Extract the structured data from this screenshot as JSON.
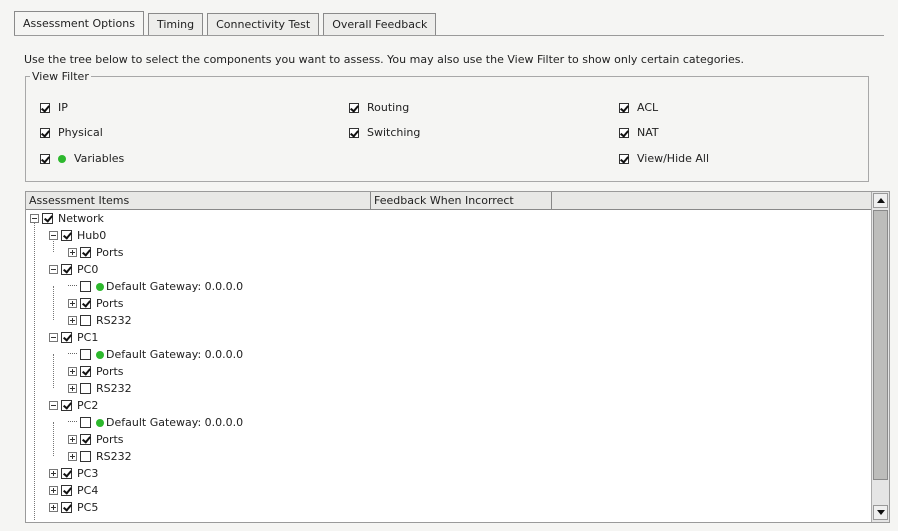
{
  "tabs": [
    {
      "label": "Assessment Options",
      "active": true
    },
    {
      "label": "Timing",
      "active": false
    },
    {
      "label": "Connectivity Test",
      "active": false
    },
    {
      "label": "Overall Feedback",
      "active": false
    }
  ],
  "intro": "Use the tree below to select the components you want to assess. You may also use the View Filter to show only certain categories.",
  "view_filter": {
    "legend": "View Filter",
    "items": [
      {
        "label": "IP",
        "checked": true
      },
      {
        "label": "Routing",
        "checked": true
      },
      {
        "label": "ACL",
        "checked": true
      },
      {
        "label": "Physical",
        "checked": true
      },
      {
        "label": "Switching",
        "checked": true
      },
      {
        "label": "NAT",
        "checked": true
      },
      {
        "label": "Variables",
        "checked": true,
        "dot_color": "#2db82d"
      },
      {
        "label": "View/Hide All",
        "checked": true
      }
    ]
  },
  "grid": {
    "columns": [
      "Assessment Items",
      "Feedback When Incorrect",
      ""
    ],
    "tree": [
      {
        "label": "Network",
        "checked": true,
        "expander": "minus",
        "level": 0
      },
      {
        "label": "Hub0",
        "checked": true,
        "expander": "minus",
        "level": 1
      },
      {
        "label": "Ports",
        "checked": true,
        "expander": "plus",
        "level": 2
      },
      {
        "label": "PC0",
        "checked": true,
        "expander": "minus",
        "level": 1
      },
      {
        "label": "Default Gateway: 0.0.0.0",
        "checked": false,
        "expander": "leaf",
        "level": 2,
        "dot": true
      },
      {
        "label": "Ports",
        "checked": true,
        "expander": "plus",
        "level": 2
      },
      {
        "label": "RS232",
        "checked": false,
        "expander": "plus",
        "level": 2
      },
      {
        "label": "PC1",
        "checked": true,
        "expander": "minus",
        "level": 1
      },
      {
        "label": "Default Gateway: 0.0.0.0",
        "checked": false,
        "expander": "leaf",
        "level": 2,
        "dot": true
      },
      {
        "label": "Ports",
        "checked": true,
        "expander": "plus",
        "level": 2
      },
      {
        "label": "RS232",
        "checked": false,
        "expander": "plus",
        "level": 2
      },
      {
        "label": "PC2",
        "checked": true,
        "expander": "minus",
        "level": 1
      },
      {
        "label": "Default Gateway: 0.0.0.0",
        "checked": false,
        "expander": "leaf",
        "level": 2,
        "dot": true
      },
      {
        "label": "Ports",
        "checked": true,
        "expander": "plus",
        "level": 2
      },
      {
        "label": "RS232",
        "checked": false,
        "expander": "plus",
        "level": 2
      },
      {
        "label": "PC3",
        "checked": true,
        "expander": "plus",
        "level": 1
      },
      {
        "label": "PC4",
        "checked": true,
        "expander": "plus",
        "level": 1
      },
      {
        "label": "PC5",
        "checked": true,
        "expander": "plus",
        "level": 1
      }
    ]
  },
  "colors": {
    "indicator_green": "#2db82d"
  }
}
